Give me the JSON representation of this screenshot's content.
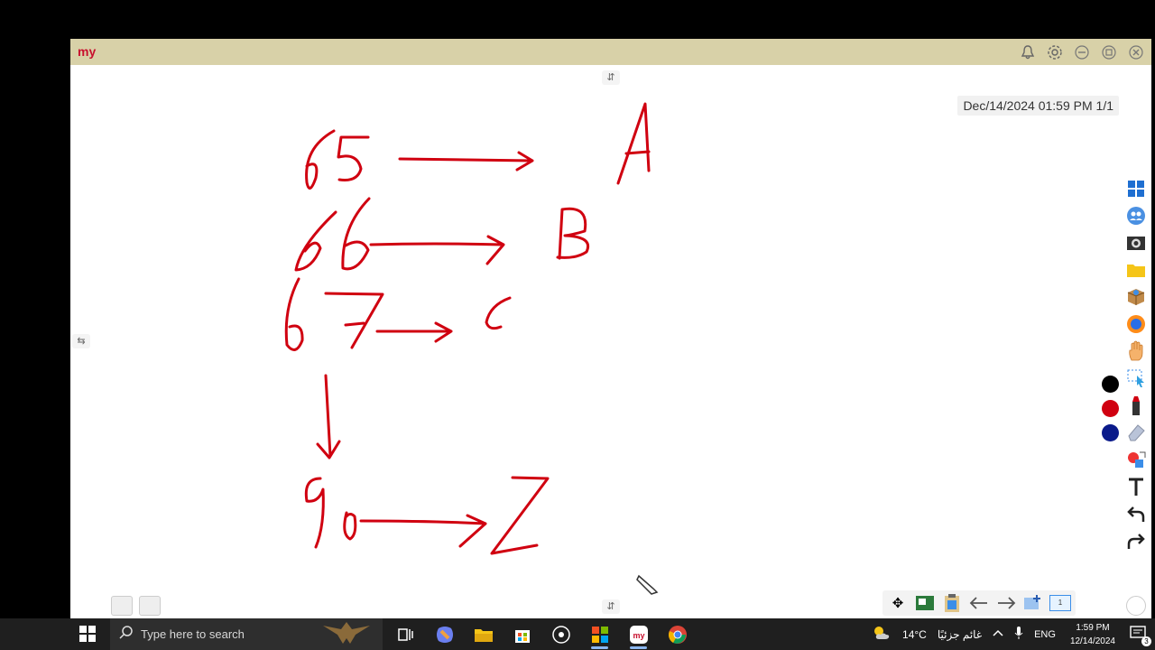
{
  "app": {
    "logo_text": "my",
    "datetime": "Dec/14/2024 01:59 PM 1/1"
  },
  "board": {
    "ink_color": "#d00010",
    "handwritten_content": [
      "65 → A",
      "66 → B",
      "67 → C",
      "↓",
      "90 → Z"
    ]
  },
  "colors": [
    "#000000",
    "#d00010",
    "#0a1a8a"
  ],
  "side_toolbar": [
    "windows-icon",
    "people-icon",
    "camera-icon",
    "folder-icon",
    "box-icon",
    "browser-icon",
    "hand-icon",
    "select-icon",
    "marker-icon",
    "eraser-icon",
    "shape-icon",
    "text-icon",
    "undo-icon",
    "redo-icon"
  ],
  "bottom_toolbar": {
    "page_number": "1"
  },
  "taskbar": {
    "search_placeholder": "Type here to search",
    "weather_temp": "14°C",
    "weather_text": "غائم جزئيًا",
    "language": "ENG",
    "time": "1:59 PM",
    "date": "12/14/2024",
    "notification_count": "3"
  }
}
